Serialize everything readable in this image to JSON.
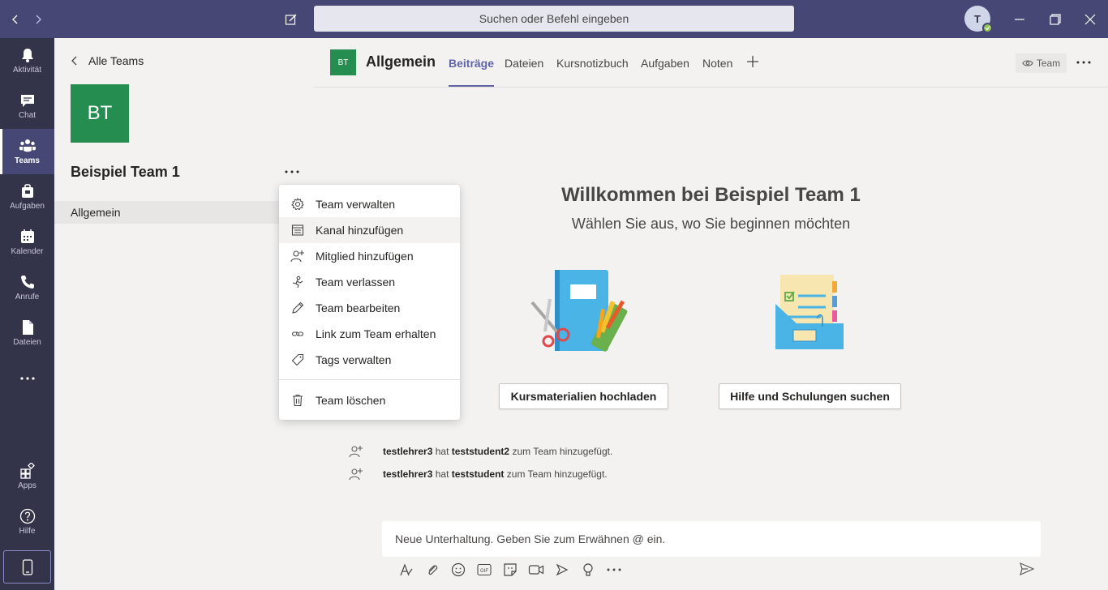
{
  "titlebar": {
    "search_placeholder": "Suchen oder Befehl eingeben",
    "avatar_initial": "T"
  },
  "rail": {
    "items": [
      {
        "label": "Aktivität",
        "icon": "bell-icon"
      },
      {
        "label": "Chat",
        "icon": "chat-icon"
      },
      {
        "label": "Teams",
        "icon": "teams-icon",
        "active": true
      },
      {
        "label": "Aufgaben",
        "icon": "assignments-icon"
      },
      {
        "label": "Kalender",
        "icon": "calendar-icon"
      },
      {
        "label": "Anrufe",
        "icon": "phone-icon"
      },
      {
        "label": "Dateien",
        "icon": "files-icon"
      }
    ],
    "apps_label": "Apps",
    "help_label": "Hilfe"
  },
  "teampanel": {
    "back_label": "Alle Teams",
    "team_initials": "BT",
    "team_name": "Beispiel Team 1",
    "channels": [
      "Allgemein"
    ]
  },
  "header": {
    "channel_initials": "BT",
    "channel_name": "Allgemein",
    "tabs": [
      "Beiträge",
      "Dateien",
      "Kursnotizbuch",
      "Aufgaben",
      "Noten"
    ],
    "team_chip": "Team"
  },
  "welcome": {
    "title": "Willkommen bei Beispiel Team 1",
    "subtitle": "Wählen Sie aus, wo Sie beginnen möchten",
    "upload_button": "Kursmaterialien hochladen",
    "help_button": "Hilfe und Schulungen suchen"
  },
  "activity": [
    {
      "actor": "testlehrer3",
      "verb": "hat",
      "target": "teststudent2",
      "rest": "zum Team hinzugefügt."
    },
    {
      "actor": "testlehrer3",
      "verb": "hat",
      "target": "teststudent",
      "rest": "zum Team hinzugefügt."
    }
  ],
  "compose": {
    "placeholder": "Neue Unterhaltung. Geben Sie zum Erwähnen @ ein.",
    "gif_label": "GIF"
  },
  "menu": {
    "items": [
      {
        "label": "Team verwalten",
        "icon": "gear-icon"
      },
      {
        "label": "Kanal hinzufügen",
        "icon": "add-channel-icon"
      },
      {
        "label": "Mitglied hinzufügen",
        "icon": "add-member-icon"
      },
      {
        "label": "Team verlassen",
        "icon": "leave-icon"
      },
      {
        "label": "Team bearbeiten",
        "icon": "pencil-icon"
      },
      {
        "label": "Link zum Team erhalten",
        "icon": "link-icon"
      },
      {
        "label": "Tags verwalten",
        "icon": "tag-icon"
      }
    ],
    "delete_label": "Team löschen"
  },
  "colors": {
    "titlebar": "#464775",
    "rail": "#33344a",
    "accent": "#6264a7",
    "team_tile": "#258d4f",
    "presence": "#92c353"
  }
}
